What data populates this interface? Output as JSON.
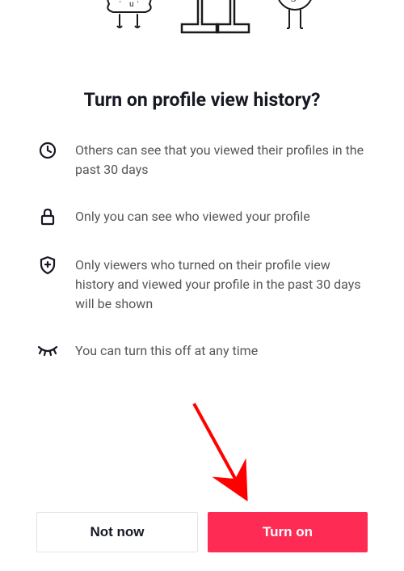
{
  "title": "Turn on profile view history?",
  "features": [
    {
      "icon": "clock-icon",
      "text": "Others can see that you viewed their profiles in the past 30 days"
    },
    {
      "icon": "lock-icon",
      "text": "Only you can see who viewed your profile"
    },
    {
      "icon": "shield-plus-icon",
      "text": "Only viewers who turned on their profile view history and viewed your profile in the past 30 days will be shown"
    },
    {
      "icon": "eye-closed-icon",
      "text": "You can turn this off at any time"
    }
  ],
  "buttons": {
    "secondary": "Not now",
    "primary": "Turn on"
  }
}
